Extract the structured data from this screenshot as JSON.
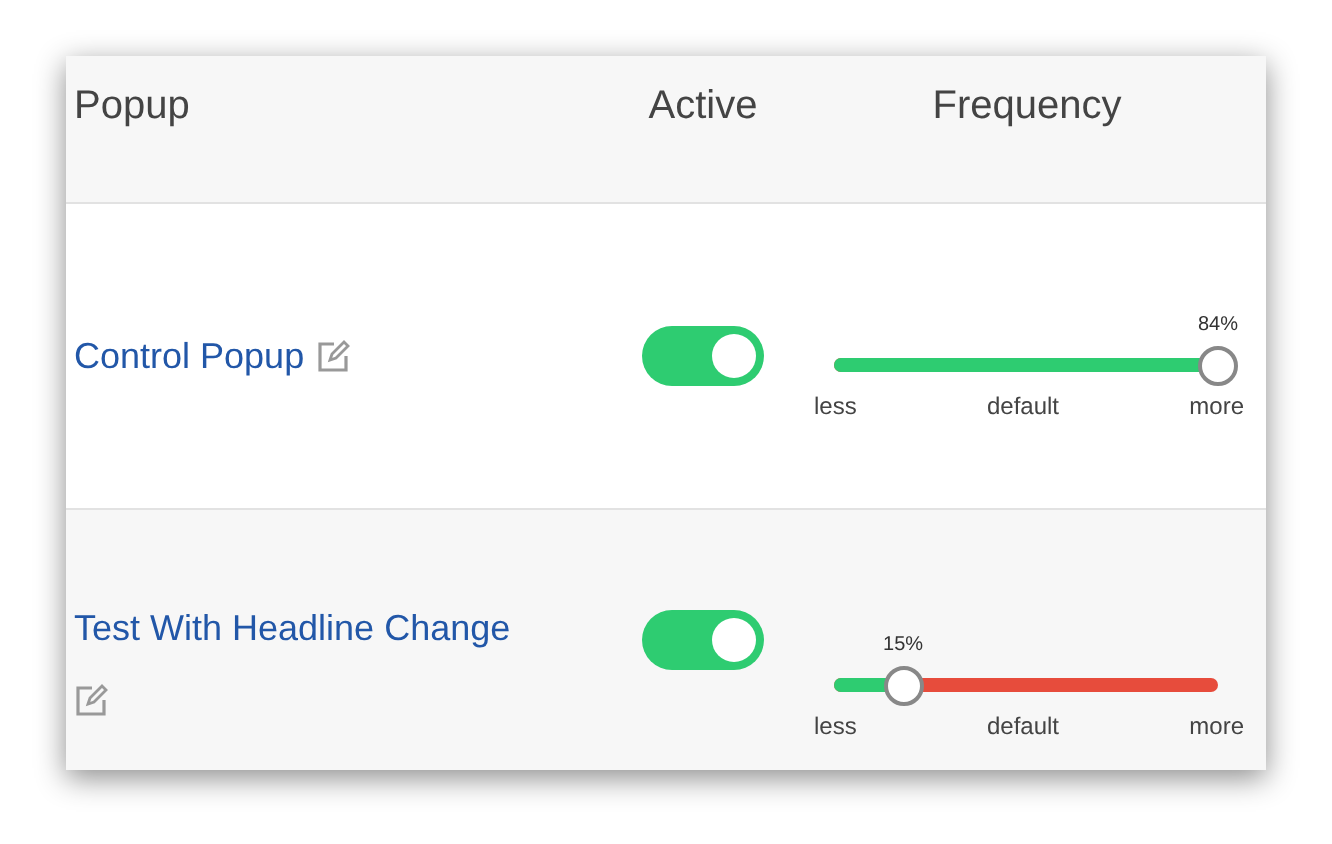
{
  "table": {
    "columns": [
      "Popup",
      "Active",
      "Frequency"
    ],
    "rows": [
      {
        "name": "Control Popup",
        "active": true,
        "frequency": {
          "level": 1.0,
          "reading": "84%",
          "labels": [
            "less",
            "default",
            "more"
          ]
        }
      },
      {
        "name": "Test With Headline Change",
        "active": true,
        "frequency": {
          "level": 0.18,
          "reading": "15%",
          "labels": [
            "less",
            "default",
            "more"
          ]
        }
      }
    ]
  }
}
